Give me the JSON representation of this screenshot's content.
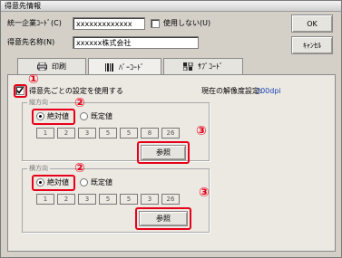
{
  "window": {
    "title": "得意先情報"
  },
  "form": {
    "code_label": "統一企業ｺｰﾄﾞ(C)",
    "code_value": "xxxxxxxxxxxxx",
    "unused_label": "使用しない(U)",
    "name_label": "得意先名称(N)",
    "name_value": "xxxxxx株式会社"
  },
  "buttons": {
    "ok": "OK",
    "cancel": "ｷｬﾝｾﾙ"
  },
  "tabs": [
    {
      "label": "印刷",
      "icon": "printer-icon"
    },
    {
      "label": "ﾊﾞｰｺｰﾄﾞ",
      "icon": "barcode-icon"
    },
    {
      "label": "ｻﾌﾞｺｰﾄﾞ",
      "icon": "subcode-icon"
    }
  ],
  "settings": {
    "use_customer_settings_label": "得意先ごとの設定を使用する",
    "current_resolution_label": "現在の解像度設定:",
    "current_resolution_value": "300dpi"
  },
  "groups": [
    {
      "title": "縦方向",
      "absolute_label": "絶対値",
      "default_label": "既定値",
      "resolutions": [
        "1",
        "2",
        "3",
        "5",
        "5",
        "8",
        "26"
      ],
      "browse_label": "参照"
    },
    {
      "title": "横方向",
      "absolute_label": "絶対値",
      "default_label": "既定値",
      "resolutions": [
        "1",
        "2",
        "3",
        "5",
        "5",
        "3",
        "26"
      ],
      "browse_label": "参照"
    }
  ],
  "markers": [
    "①",
    "②",
    "③",
    "②",
    "③"
  ],
  "colors": {
    "highlight": "#e8001a",
    "resolution_value": "#1a3fb4"
  }
}
